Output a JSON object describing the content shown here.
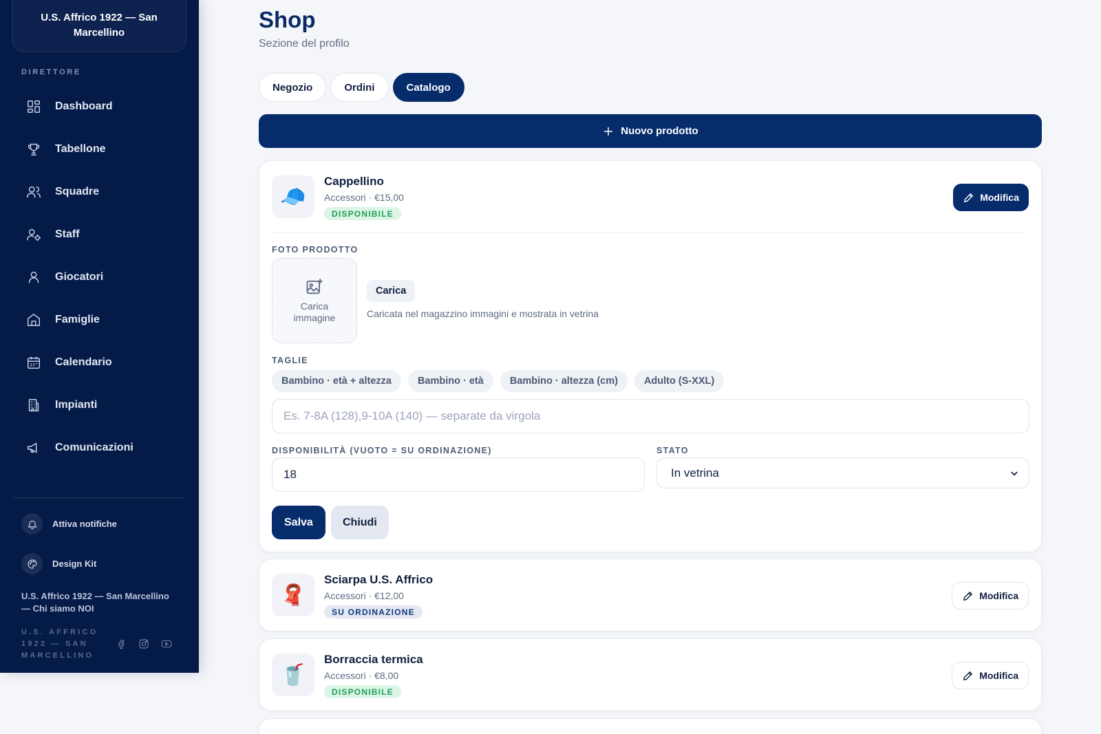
{
  "sidebar": {
    "club_name": "U.S. Affrico 1922 — San Marcellino",
    "section_label": "DIRETTORE",
    "nav": [
      {
        "label": "Dashboard",
        "icon": "dashboard-icon"
      },
      {
        "label": "Tabellone",
        "icon": "trophy-icon"
      },
      {
        "label": "Squadre",
        "icon": "users-icon"
      },
      {
        "label": "Staff",
        "icon": "staff-icon"
      },
      {
        "label": "Giocatori",
        "icon": "user-icon"
      },
      {
        "label": "Famiglie",
        "icon": "home-icon"
      },
      {
        "label": "Calendario",
        "icon": "calendar-icon"
      },
      {
        "label": "Impianti",
        "icon": "building-icon"
      },
      {
        "label": "Comunicazioni",
        "icon": "megaphone-icon"
      }
    ],
    "notifications_label": "Attiva notifiche",
    "design_kit_label": "Design Kit",
    "footer_title": "U.S. Affrico 1922 — San Marcellino — Chi siamo NOI",
    "footer_small": "U.S. AFFRICO 1922 — SAN MARCELLINO"
  },
  "page": {
    "title": "Shop",
    "subtitle": "Sezione del profilo",
    "tabs": [
      {
        "label": "Negozio",
        "active": false
      },
      {
        "label": "Ordini",
        "active": false
      },
      {
        "label": "Catalogo",
        "active": true
      }
    ],
    "new_product_label": "Nuovo prodotto"
  },
  "products": [
    {
      "name": "Cappellino",
      "meta": "Accessori · €15,00",
      "status": "DISPONIBILE",
      "status_color": "green",
      "emoji": "🧢",
      "edit_label": "Modifica"
    },
    {
      "name": "Sciarpa U.S. Affrico",
      "meta": "Accessori · €12,00",
      "status": "SU ORDINAZIONE",
      "status_color": "blue",
      "emoji": "🧣",
      "edit_label": "Modifica"
    },
    {
      "name": "Borraccia termica",
      "meta": "Accessori · €8,00",
      "status": "DISPONIBILE",
      "status_color": "green",
      "emoji": "🥤",
      "edit_label": "Modifica"
    }
  ],
  "editor": {
    "photo_label": "FOTO PRODOTTO",
    "upload_box_label": "Carica immagine",
    "upload_button": "Carica",
    "upload_hint": "Caricata nel magazzino immagini e mostrata in vetrina",
    "sizes_label": "TAGLIE",
    "size_chips": [
      "Bambino · età + altezza",
      "Bambino · età",
      "Bambino · altezza (cm)",
      "Adulto (S-XXL)"
    ],
    "sizes_placeholder": "Es. 7-8A (128),9-10A (140) — separate da virgola",
    "availability_label": "DISPONIBILITÀ (VUOTO = SU ORDINAZIONE)",
    "availability_value": "18",
    "status_label": "STATO",
    "status_value": "In vetrina",
    "save_label": "Salva",
    "close_label": "Chiudi"
  },
  "colors": {
    "sidebar_bg": "#041a47",
    "primary": "#062c6b",
    "available_green": "#1f9e58",
    "club_gold": "#e8a61a"
  }
}
